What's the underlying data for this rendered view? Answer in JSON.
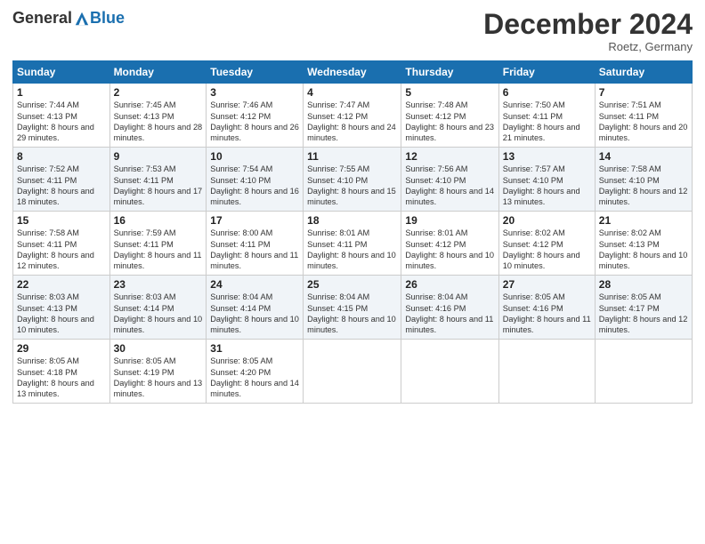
{
  "header": {
    "logo_general": "General",
    "logo_blue": "Blue",
    "month_title": "December 2024",
    "location": "Roetz, Germany"
  },
  "calendar": {
    "days_of_week": [
      "Sunday",
      "Monday",
      "Tuesday",
      "Wednesday",
      "Thursday",
      "Friday",
      "Saturday"
    ],
    "weeks": [
      [
        null,
        {
          "day": "2",
          "sunrise": "7:45 AM",
          "sunset": "4:13 PM",
          "daylight": "8 hours and 28 minutes."
        },
        {
          "day": "3",
          "sunrise": "7:46 AM",
          "sunset": "4:12 PM",
          "daylight": "8 hours and 26 minutes."
        },
        {
          "day": "4",
          "sunrise": "7:47 AM",
          "sunset": "4:12 PM",
          "daylight": "8 hours and 24 minutes."
        },
        {
          "day": "5",
          "sunrise": "7:48 AM",
          "sunset": "4:12 PM",
          "daylight": "8 hours and 23 minutes."
        },
        {
          "day": "6",
          "sunrise": "7:50 AM",
          "sunset": "4:11 PM",
          "daylight": "8 hours and 21 minutes."
        },
        {
          "day": "7",
          "sunrise": "7:51 AM",
          "sunset": "4:11 PM",
          "daylight": "8 hours and 20 minutes."
        }
      ],
      [
        {
          "day": "1",
          "sunrise": "7:44 AM",
          "sunset": "4:13 PM",
          "daylight": "8 hours and 29 minutes."
        },
        {
          "day": "9",
          "sunrise": "7:53 AM",
          "sunset": "4:11 PM",
          "daylight": "8 hours and 17 minutes."
        },
        {
          "day": "10",
          "sunrise": "7:54 AM",
          "sunset": "4:10 PM",
          "daylight": "8 hours and 16 minutes."
        },
        {
          "day": "11",
          "sunrise": "7:55 AM",
          "sunset": "4:10 PM",
          "daylight": "8 hours and 15 minutes."
        },
        {
          "day": "12",
          "sunrise": "7:56 AM",
          "sunset": "4:10 PM",
          "daylight": "8 hours and 14 minutes."
        },
        {
          "day": "13",
          "sunrise": "7:57 AM",
          "sunset": "4:10 PM",
          "daylight": "8 hours and 13 minutes."
        },
        {
          "day": "14",
          "sunrise": "7:58 AM",
          "sunset": "4:10 PM",
          "daylight": "8 hours and 12 minutes."
        }
      ],
      [
        {
          "day": "8",
          "sunrise": "7:52 AM",
          "sunset": "4:11 PM",
          "daylight": "8 hours and 18 minutes."
        },
        {
          "day": "16",
          "sunrise": "7:59 AM",
          "sunset": "4:11 PM",
          "daylight": "8 hours and 11 minutes."
        },
        {
          "day": "17",
          "sunrise": "8:00 AM",
          "sunset": "4:11 PM",
          "daylight": "8 hours and 11 minutes."
        },
        {
          "day": "18",
          "sunrise": "8:01 AM",
          "sunset": "4:11 PM",
          "daylight": "8 hours and 10 minutes."
        },
        {
          "day": "19",
          "sunrise": "8:01 AM",
          "sunset": "4:12 PM",
          "daylight": "8 hours and 10 minutes."
        },
        {
          "day": "20",
          "sunrise": "8:02 AM",
          "sunset": "4:12 PM",
          "daylight": "8 hours and 10 minutes."
        },
        {
          "day": "21",
          "sunrise": "8:02 AM",
          "sunset": "4:13 PM",
          "daylight": "8 hours and 10 minutes."
        }
      ],
      [
        {
          "day": "15",
          "sunrise": "7:58 AM",
          "sunset": "4:11 PM",
          "daylight": "8 hours and 12 minutes."
        },
        {
          "day": "23",
          "sunrise": "8:03 AM",
          "sunset": "4:14 PM",
          "daylight": "8 hours and 10 minutes."
        },
        {
          "day": "24",
          "sunrise": "8:04 AM",
          "sunset": "4:14 PM",
          "daylight": "8 hours and 10 minutes."
        },
        {
          "day": "25",
          "sunrise": "8:04 AM",
          "sunset": "4:15 PM",
          "daylight": "8 hours and 10 minutes."
        },
        {
          "day": "26",
          "sunrise": "8:04 AM",
          "sunset": "4:16 PM",
          "daylight": "8 hours and 11 minutes."
        },
        {
          "day": "27",
          "sunrise": "8:05 AM",
          "sunset": "4:16 PM",
          "daylight": "8 hours and 11 minutes."
        },
        {
          "day": "28",
          "sunrise": "8:05 AM",
          "sunset": "4:17 PM",
          "daylight": "8 hours and 12 minutes."
        }
      ],
      [
        {
          "day": "22",
          "sunrise": "8:03 AM",
          "sunset": "4:13 PM",
          "daylight": "8 hours and 10 minutes."
        },
        {
          "day": "30",
          "sunrise": "8:05 AM",
          "sunset": "4:19 PM",
          "daylight": "8 hours and 13 minutes."
        },
        {
          "day": "31",
          "sunrise": "8:05 AM",
          "sunset": "4:20 PM",
          "daylight": "8 hours and 14 minutes."
        },
        null,
        null,
        null,
        null
      ],
      [
        {
          "day": "29",
          "sunrise": "8:05 AM",
          "sunset": "4:18 PM",
          "daylight": "8 hours and 13 minutes."
        },
        null,
        null,
        null,
        null,
        null,
        null
      ]
    ]
  }
}
